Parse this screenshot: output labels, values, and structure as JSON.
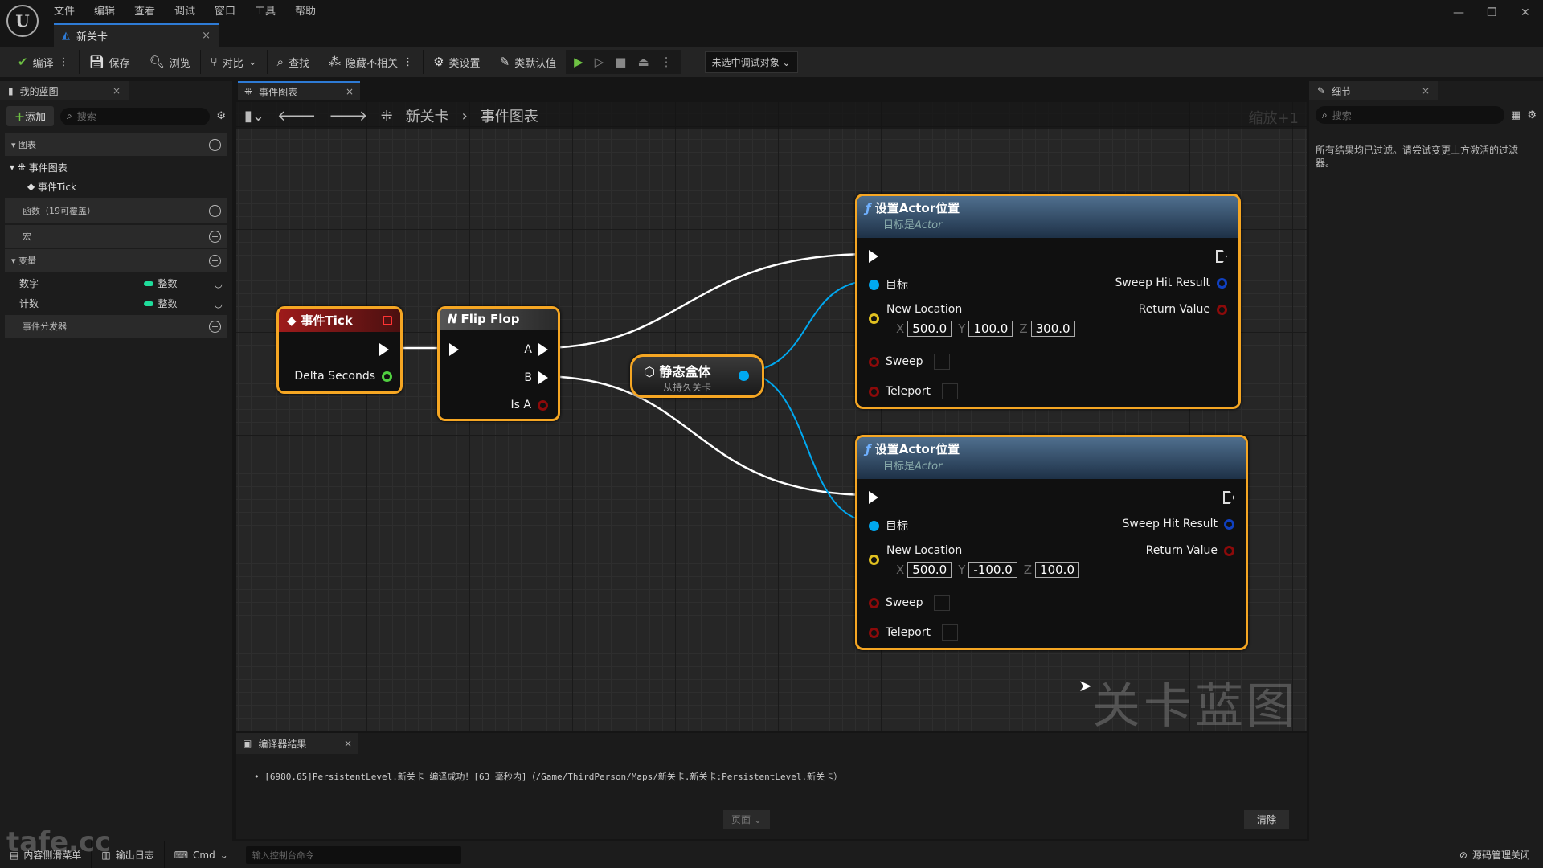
{
  "app": {
    "logo": "U",
    "menu": [
      "文件",
      "编辑",
      "查看",
      "调试",
      "窗口",
      "工具",
      "帮助"
    ],
    "doc_tab": "新关卡",
    "window_controls": [
      "—",
      "❐",
      "✕"
    ]
  },
  "toolbar": {
    "compile": "编译",
    "save": "保存",
    "browse": "浏览",
    "diff": "对比",
    "find": "查找",
    "hide_unrelated": "隐藏不相关",
    "class_settings": "类设置",
    "class_defaults": "类默认值",
    "debug_target": "未选中调试对象"
  },
  "my_blueprint": {
    "tab": "我的蓝图",
    "add": "添加",
    "search_placeholder": "搜索",
    "sections": {
      "graphs": "图表",
      "functions": "函数（19可覆盖）",
      "macros": "宏",
      "variables": "变量",
      "dispatchers": "事件分发器"
    },
    "graph_tree": {
      "event_graph": "事件图表",
      "event_tick": "事件Tick"
    },
    "variables": [
      {
        "name": "数字",
        "type": "整数"
      },
      {
        "name": "计数",
        "type": "整数"
      }
    ],
    "var_color": "#1fdc9b"
  },
  "graph": {
    "tab": "事件图表",
    "breadcrumb": [
      "新关卡",
      "事件图表"
    ],
    "zoom": "缩放+1",
    "watermark": "关卡蓝图",
    "event_tick": {
      "title": "事件Tick",
      "pin": "Delta Seconds"
    },
    "flip_flop": {
      "title": "Flip Flop",
      "pins": [
        "A",
        "B",
        "Is A"
      ]
    },
    "static_mesh": {
      "title": "静态盒体",
      "subtitle": "从持久关卡"
    },
    "set_location_nodes": [
      {
        "title": "设置Actor位置",
        "subtitle_prefix": "目标是",
        "subtitle_em": "Actor",
        "target": "目标",
        "new_location": "New Location",
        "x": "500.0",
        "y": "100.0",
        "z": "300.0",
        "sweep": "Sweep",
        "teleport": "Teleport",
        "sweep_hit": "Sweep Hit Result",
        "return_value": "Return Value"
      },
      {
        "title": "设置Actor位置",
        "subtitle_prefix": "目标是",
        "subtitle_em": "Actor",
        "target": "目标",
        "new_location": "New Location",
        "x": "500.0",
        "y": "-100.0",
        "z": "100.0",
        "sweep": "Sweep",
        "teleport": "Teleport",
        "sweep_hit": "Sweep Hit Result",
        "return_value": "Return Value"
      }
    ],
    "colors": {
      "selection": "#f5a623",
      "object_pin": "#00a8f0",
      "vector_pin": "#e0c020",
      "bool_pin": "#8c0a0a",
      "float_pin": "#50d040",
      "struct_pin": "#1040c0"
    }
  },
  "details": {
    "tab": "细节",
    "search_placeholder": "搜索",
    "empty_message": "所有结果均已过滤。请尝试变更上方激活的过滤器。"
  },
  "compiler": {
    "tab": "编译器结果",
    "message": "[6980.65]PersistentLevel.新关卡 编译成功！[63 毫秒内]（/Game/ThirdPerson/Maps/新关卡.新关卡:PersistentLevel.新关卡）",
    "page": "页面",
    "clear": "清除"
  },
  "statusbar": {
    "content_drawer": "内容侧滑菜单",
    "output_log": "输出日志",
    "cmd": "Cmd",
    "cmd_placeholder": "输入控制台命令",
    "source_control": "源码管理关闭"
  },
  "overlay": {
    "site_watermark": "tafe.cc"
  }
}
